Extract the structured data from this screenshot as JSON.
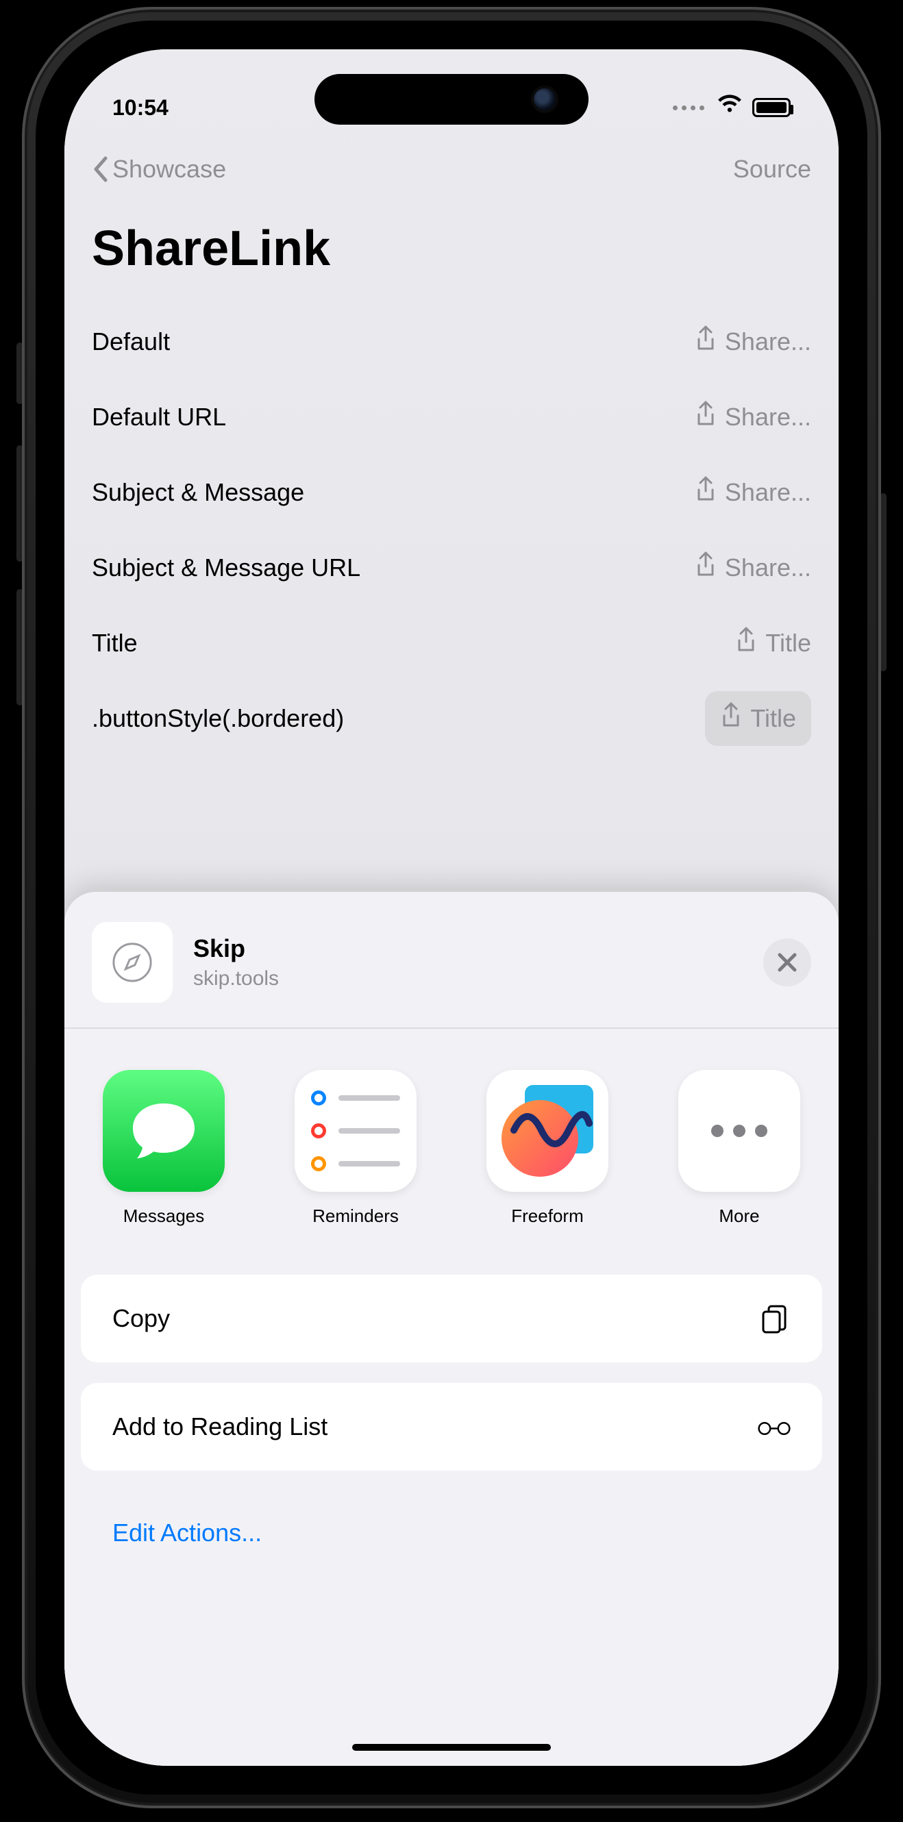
{
  "status_time": "10:54",
  "nav": {
    "back_label": "Showcase",
    "right_label": "Source"
  },
  "page_title": "ShareLink",
  "rows": [
    {
      "label": "Default",
      "button": "Share..."
    },
    {
      "label": "Default URL",
      "button": "Share..."
    },
    {
      "label": "Subject & Message",
      "button": "Share..."
    },
    {
      "label": "Subject & Message URL",
      "button": "Share..."
    },
    {
      "label": "Title",
      "button": "Title"
    },
    {
      "label": ".buttonStyle(.bordered)",
      "button": "Title"
    }
  ],
  "sheet": {
    "title": "Skip",
    "subtitle": "skip.tools",
    "apps": [
      {
        "label": "Messages"
      },
      {
        "label": "Reminders"
      },
      {
        "label": "Freeform"
      },
      {
        "label": "More"
      }
    ],
    "actions": {
      "copy": "Copy",
      "reading_list": "Add to Reading List",
      "edit": "Edit Actions..."
    }
  }
}
